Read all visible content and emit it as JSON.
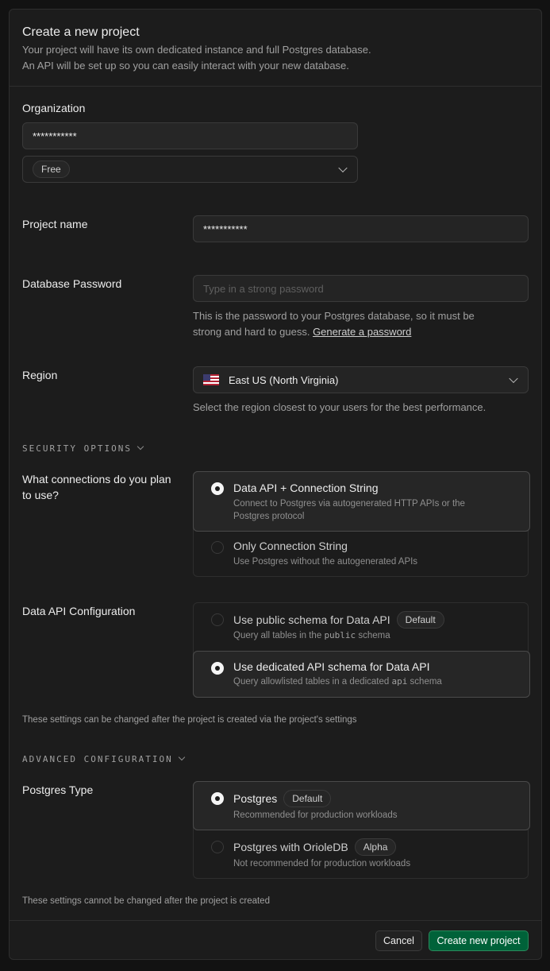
{
  "header": {
    "title": "Create a new project",
    "subtitle_line1": "Your project will have its own dedicated instance and full Postgres database.",
    "subtitle_line2": "An API will be set up so you can easily interact with your new database."
  },
  "organization": {
    "label": "Organization",
    "value": "***********",
    "plan_badge": "Free"
  },
  "project_name": {
    "label": "Project name",
    "value": "***********"
  },
  "database_password": {
    "label": "Database Password",
    "placeholder": "Type in a strong password",
    "help_line1": "This is the password to your Postgres database, so it must be",
    "help_line2_prefix": "strong and hard to guess.",
    "generate_link": "Generate a password"
  },
  "region": {
    "label": "Region",
    "value": "East US (North Virginia)",
    "flag_icon": "us-flag-icon",
    "help": "Select the region closest to your users for the best performance."
  },
  "security_options": {
    "heading": "SECURITY OPTIONS",
    "connections": {
      "label_line1": "What connections do you plan",
      "label_line2": "to use?",
      "options": [
        {
          "title": "Data API + Connection String",
          "desc_line1": "Connect to Postgres via autogenerated HTTP APIs or the",
          "desc_line2": "Postgres protocol",
          "selected": true
        },
        {
          "title": "Only Connection String",
          "desc_line1": "Use Postgres without the autogenerated APIs",
          "selected": false
        }
      ]
    },
    "data_api": {
      "label": "Data API Configuration",
      "options": [
        {
          "title": "Use public schema for Data API",
          "badge": "Default",
          "desc_prefix": "Query all tables in the",
          "desc_code": "public",
          "desc_suffix": "schema",
          "selected": false
        },
        {
          "title": "Use dedicated API schema for Data API",
          "desc_prefix": "Query allowlisted tables in a dedicated",
          "desc_code": "api",
          "desc_suffix": "schema",
          "selected": true
        }
      ]
    },
    "note": "These settings can be changed after the project is created via the project's settings"
  },
  "advanced_configuration": {
    "heading": "ADVANCED CONFIGURATION",
    "postgres_type": {
      "label": "Postgres Type",
      "options": [
        {
          "title": "Postgres",
          "badge": "Default",
          "desc": "Recommended for production workloads",
          "selected": true
        },
        {
          "title": "Postgres with OrioleDB",
          "badge": "Alpha",
          "desc": "Not recommended for production workloads",
          "selected": false
        }
      ]
    },
    "note": "These settings cannot be changed after the project is created"
  },
  "footer": {
    "cancel_label": "Cancel",
    "create_label": "Create new project"
  },
  "colors": {
    "background": "#1c1c1c",
    "primary_button": "#006239",
    "border": "#2e2e2e"
  }
}
